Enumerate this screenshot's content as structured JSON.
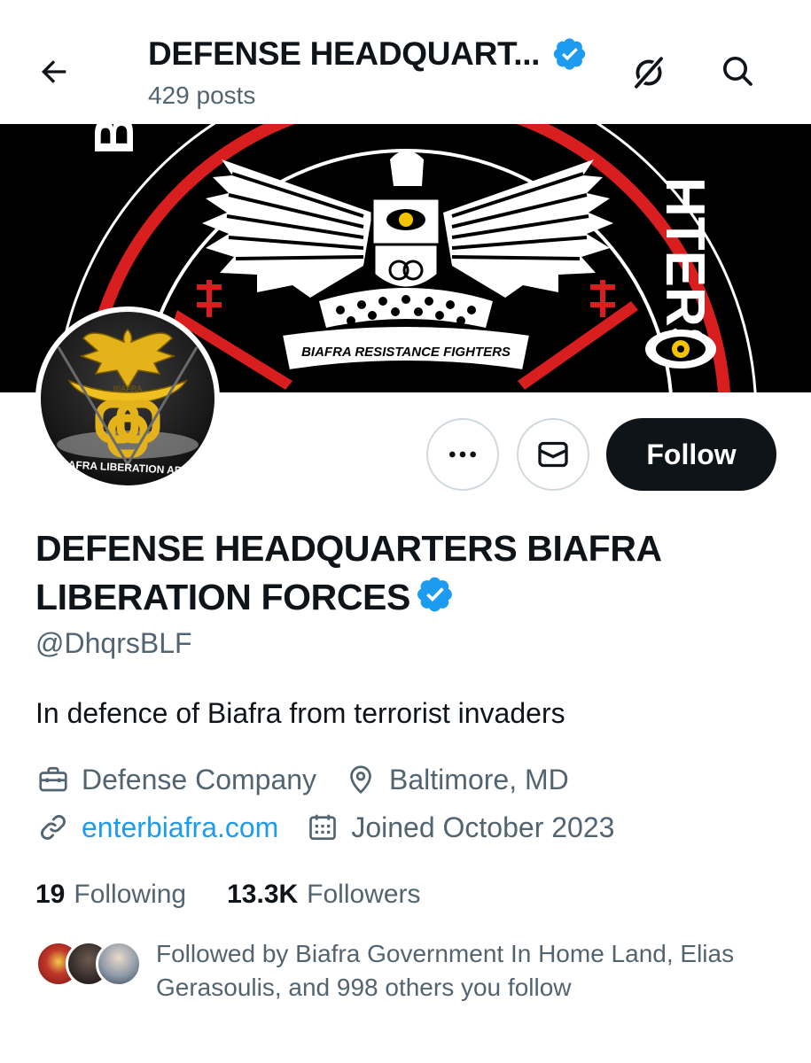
{
  "header": {
    "title": "DEFENSE HEADQUART...",
    "posts": "429 posts",
    "icons": [
      "back-arrow-icon",
      "grok-icon",
      "search-icon"
    ]
  },
  "banner": {
    "text_left": "BIAFRA",
    "text_right": "HTERS",
    "ribbon": "BIAFRA RESISTANCE FIGHTERS"
  },
  "avatar": {
    "ribbon": "BIAFRA",
    "caption": "BIAFRA LIBERATION ARMY"
  },
  "actions": {
    "more_icon": "more-horizontal-icon",
    "message_icon": "envelope-icon",
    "follow_label": "Follow"
  },
  "profile": {
    "name": "DEFENSE HEADQUARTERS BIAFRA LIBERATION FORCES",
    "handle": "@DhqrsBLF",
    "bio": "In defence of Biafra from terrorist invaders",
    "category": "Defense Company",
    "location": "Baltimore, MD",
    "website": "enterbiafra.com",
    "joined": "Joined October 2023"
  },
  "stats": {
    "following_count": "19",
    "following_label": "Following",
    "followers_count": "13.3K",
    "followers_label": "Followers"
  },
  "followed_by": {
    "text": "Followed by Biafra Government In Home Land, Elias Gerasoulis, and 998 others you follow"
  },
  "colors": {
    "accent": "#1d9bf0",
    "text_primary": "#0f1419",
    "text_secondary": "#536471",
    "follow_button": "#0f1419",
    "banner_red": "#d81e1e"
  }
}
